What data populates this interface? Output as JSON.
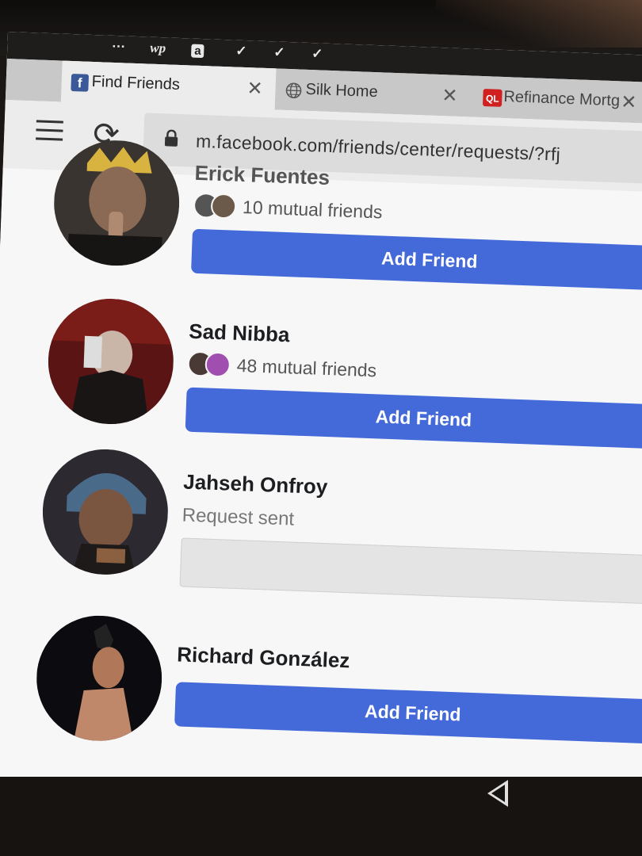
{
  "status_bar": {
    "overflow": "···",
    "wp": "wp",
    "amazon": "a",
    "checks": [
      "✓",
      "✓",
      "✓"
    ]
  },
  "tabs": [
    {
      "label": "Find Friends",
      "favicon": "f",
      "favicon_color": "#3b5998",
      "active": true
    },
    {
      "label": "Silk Home",
      "favicon": "globe-icon",
      "active": false
    },
    {
      "label": "Refinance Mortg",
      "favicon": "QL",
      "favicon_color": "#d02020",
      "active": false
    }
  ],
  "toolbar": {
    "url": "m.facebook.com/friends/center/requests/?rfj"
  },
  "people": [
    {
      "name": "Erick Fuentes",
      "mutual": "10 mutual friends",
      "action": "Add Friend"
    },
    {
      "name": "Sad Nibba",
      "mutual": "48 mutual friends",
      "action": "Add Friend"
    },
    {
      "name": "Jahseh Onfroy",
      "status": "Request sent"
    },
    {
      "name": "Richard González",
      "action": "Add Friend"
    }
  ],
  "colors": {
    "accent": "#4469d9",
    "facebook": "#3b5998"
  }
}
